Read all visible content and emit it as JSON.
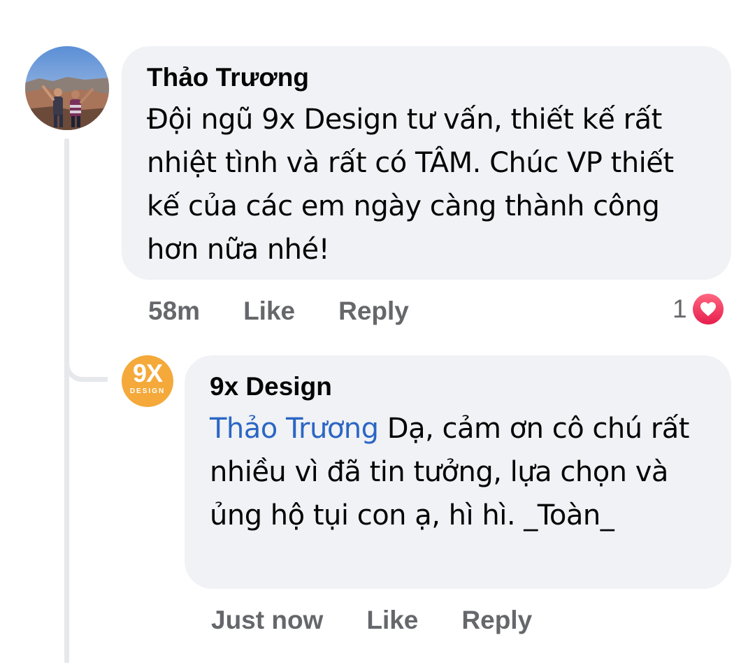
{
  "comments": [
    {
      "author": "Thảo Trương",
      "text": "Đội ngũ 9x Design tư vấn, thiết kế rất nhiệt tình và rất có TÂM. Chúc VP thiết kế của các em ngày càng thành công hơn nữa nhé!",
      "time": "58m",
      "like_label": "Like",
      "reply_label": "Reply",
      "reaction_count": "1",
      "reaction_icon": "heart-icon",
      "avatar_icon": "profile-photo"
    },
    {
      "author": "9x Design",
      "mention": "Thảo Trương",
      "text": " Dạ, cảm ơn cô chú rất nhiều vì đã tin tưởng, lựa chọn và ủng hộ tụi con ạ, hì hì. _Toàn_",
      "time": "Just now",
      "like_label": "Like",
      "reply_label": "Reply",
      "avatar_logo_main": "9X",
      "avatar_logo_sub": "DESIGN"
    }
  ],
  "colors": {
    "bubble": "#f0f2f5",
    "mention": "#2b66c4",
    "meta_text": "#65676b",
    "heart": "#e61e4d",
    "logo": "#f4a93a"
  }
}
